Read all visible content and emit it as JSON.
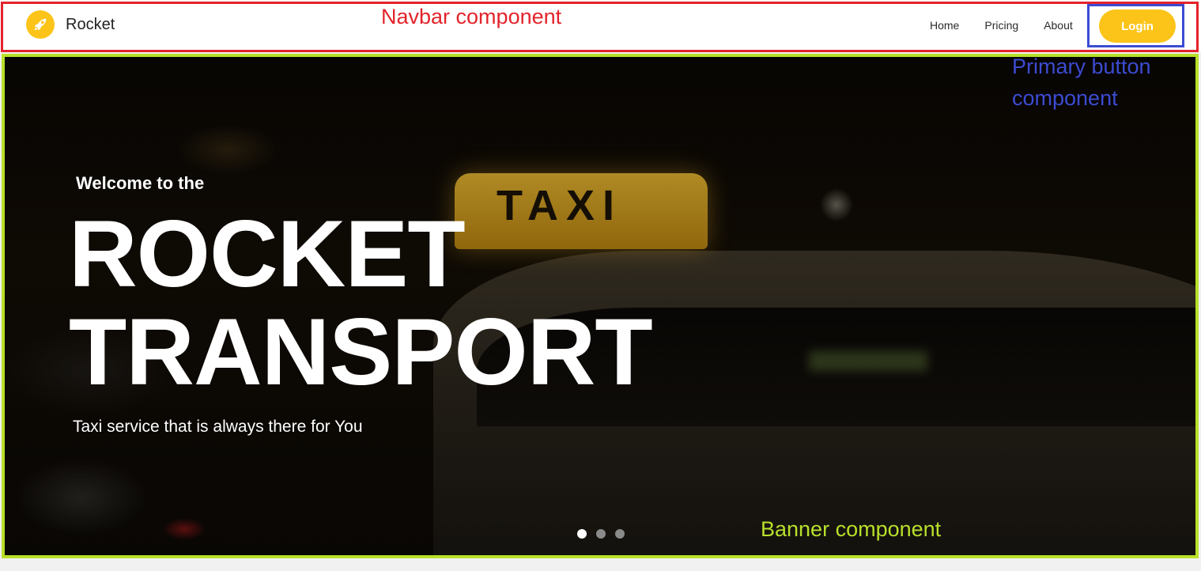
{
  "navbar": {
    "brand_name": "Rocket",
    "logo_icon": "rocket-icon",
    "links": [
      "Home",
      "Pricing",
      "About"
    ],
    "login_label": "Login"
  },
  "annotations": {
    "navbar": "Navbar component",
    "primary_button": "Primary button component",
    "banner": "Banner component"
  },
  "banner": {
    "welcome": "Welcome to the",
    "headline_line1": "ROCKET",
    "headline_line2": "TRANSPORT",
    "subtitle": "Taxi service that is always there for You",
    "sign_text": "TAXI",
    "slides": 3,
    "active_slide": 1
  },
  "colors": {
    "brand_yellow": "#fcc419",
    "navbar_outline": "#e3232b",
    "button_outline": "#3c4bd2",
    "banner_outline": "#b8e02a"
  }
}
